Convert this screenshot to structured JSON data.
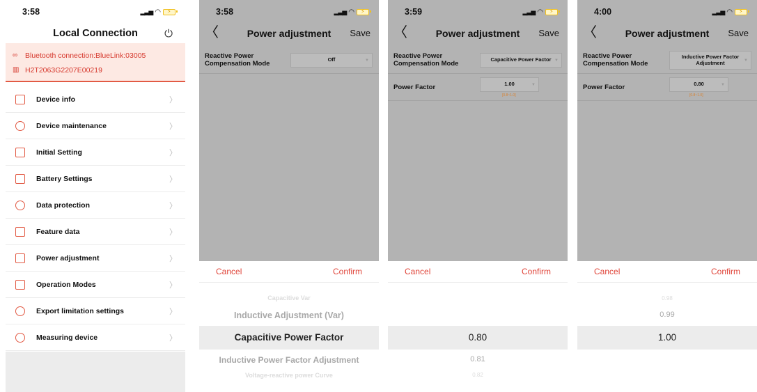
{
  "screen1": {
    "time": "3:58",
    "title": "Local Connection",
    "bluetooth": "Bluetooth connection:BlueLink:03005",
    "serial": "H2T2063G2207E00219",
    "menu": [
      {
        "label": "Device info",
        "icon": "document-icon"
      },
      {
        "label": "Device maintenance",
        "icon": "tools-icon"
      },
      {
        "label": "Initial Setting",
        "icon": "settings-building-icon"
      },
      {
        "label": "Battery Settings",
        "icon": "battery-icon"
      },
      {
        "label": "Data protection",
        "icon": "shield-icon"
      },
      {
        "label": "Feature data",
        "icon": "briefcase-icon"
      },
      {
        "label": "Power adjustment",
        "icon": "chart-icon"
      },
      {
        "label": "Operation Modes",
        "icon": "image-icon"
      },
      {
        "label": "Export limitation settings",
        "icon": "info-icon"
      },
      {
        "label": "Measuring device",
        "icon": "gauge-icon"
      }
    ],
    "accent": "#e25a44"
  },
  "screen2": {
    "time": "3:58",
    "title": "Power adjustment",
    "save": "Save",
    "mode_label": "Reactive Power Compensation Mode",
    "mode_value": "Off",
    "cancel": "Cancel",
    "confirm": "Confirm",
    "picker": [
      "Capacitive Var",
      "Inductive Adjustment (Var)",
      "Capacitive Power Factor",
      "Inductive Power Factor Adjustment",
      "Voltage-reactive power Curve"
    ]
  },
  "screen3": {
    "time": "3:59",
    "title": "Power adjustment",
    "save": "Save",
    "mode_label": "Reactive Power Compensation Mode",
    "mode_value": "Capacitive Power Factor",
    "pf_label": "Power Factor",
    "pf_value": "1.00",
    "pf_range": "[0.8~1.0]",
    "cancel": "Cancel",
    "confirm": "Confirm",
    "picker": [
      "0.80",
      "0.81",
      "0.82"
    ]
  },
  "screen4": {
    "time": "4:00",
    "title": "Power adjustment",
    "save": "Save",
    "mode_label": "Reactive Power Compensation Mode",
    "mode_value": "Inductive Power Factor Adjustment",
    "pf_label": "Power Factor",
    "pf_value": "0.80",
    "pf_range": "[0.8~1.0]",
    "cancel": "Cancel",
    "confirm": "Confirm",
    "picker": [
      "0.98",
      "0.99",
      "1.00"
    ]
  }
}
